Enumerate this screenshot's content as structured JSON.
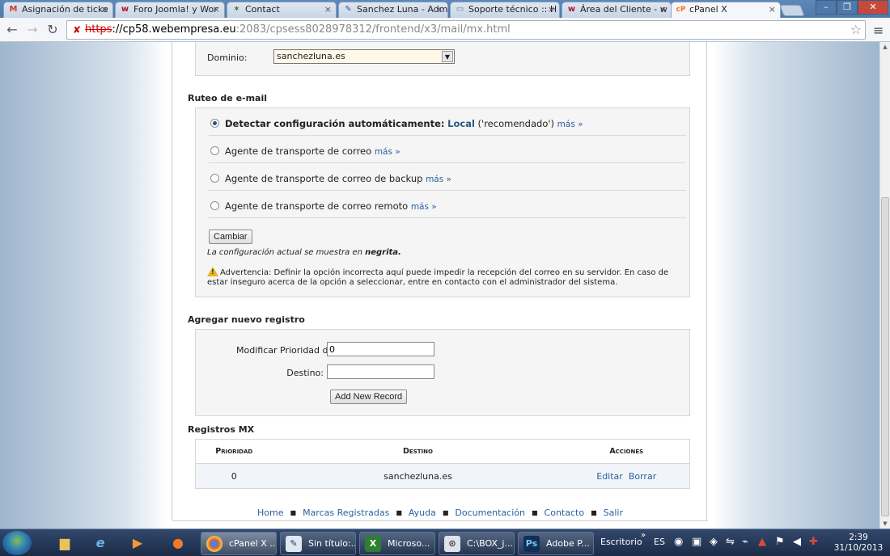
{
  "browser": {
    "tabs": [
      {
        "label": "Asignación de ticke",
        "icon": "gmail-icon",
        "favicon_text": "M",
        "favicon_color": "#cc3b2c"
      },
      {
        "label": "Foro Joomla! y Wor",
        "icon": "webempresa-icon",
        "favicon_text": "w",
        "favicon_color": "#b5122d"
      },
      {
        "label": "Contact",
        "icon": "joomla-icon",
        "favicon_text": "✶",
        "favicon_color": "#2f6e35"
      },
      {
        "label": "Sanchez Luna - Adm",
        "icon": "pencil-icon",
        "favicon_text": "✎",
        "favicon_color": "#2c5fa0"
      },
      {
        "label": "Soporte técnico :: H",
        "icon": "page-icon",
        "favicon_text": "▭",
        "favicon_color": "#777777"
      },
      {
        "label": "Área del Cliente - w",
        "icon": "webempresa-icon",
        "favicon_text": "w",
        "favicon_color": "#b5122d"
      },
      {
        "label": "cPanel X",
        "icon": "cpanel-icon",
        "favicon_text": "cP",
        "favicon_color": "#ff6c2c"
      }
    ],
    "url": {
      "scheme": "https",
      "host": "://cp58.webempresa.eu",
      "path": ":2083/cpsess8028978312/frontend/x3/mail/mx.html"
    }
  },
  "page": {
    "domain_label": "Dominio:",
    "domain_value": "sanchezluna.es",
    "routing": {
      "title": "Ruteo de e-mail",
      "options": [
        {
          "label": "Detectar configuración automáticamente:",
          "bold": true,
          "extra_local": "Local",
          "extra_rest": " ('recomendado')",
          "more": "más »",
          "checked": true
        },
        {
          "label": "Agente de transporte de correo",
          "bold": false,
          "more": "más »",
          "checked": false
        },
        {
          "label": "Agente de transporte de correo de backup",
          "bold": false,
          "more": "más »",
          "checked": false
        },
        {
          "label": "Agente de transporte de correo remoto",
          "bold": false,
          "more": "más »",
          "checked": false
        }
      ],
      "change_button": "Cambiar",
      "current_note_prefix": "La configuración actual se muestra en ",
      "current_note_bold": "negrita.",
      "warning": "Advertencia: Definir la opción incorrecta aquí puede impedir la recepción del correo en su servidor. En caso de estar inseguro acerca de la opción a seleccionar, entre en contacto con el administrador del sistema."
    },
    "new_record": {
      "title": "Agregar nuevo registro",
      "priority_label": "Modificar Prioridad de",
      "priority_value": "0",
      "destination_label": "Destino:",
      "destination_value": "",
      "add_button": "Add New Record"
    },
    "mx_records": {
      "title": "Registros MX",
      "columns": [
        "Prioridad",
        "Destino",
        "Acciones"
      ],
      "rows": [
        {
          "priority": "0",
          "destination": "sanchezluna.es",
          "edit": "Editar",
          "delete": "Borrar"
        }
      ]
    },
    "footer_links": [
      "Home",
      "Marcas Registradas",
      "Ayuda",
      "Documentación",
      "Contacto",
      "Salir"
    ]
  },
  "taskbar": {
    "buttons": [
      {
        "label": "cPanel X ...",
        "icon": "chrome-icon"
      },
      {
        "label": "Sin título:...",
        "icon": "notepad-icon"
      },
      {
        "label": "Microso...",
        "icon": "excel-icon"
      },
      {
        "label": "C:\\BOX_j...",
        "icon": "vpn-icon"
      },
      {
        "label": "Adobe P...",
        "icon": "photoshop-icon"
      }
    ],
    "desktop_label": "Escritorio",
    "lang": "ES",
    "time": "2:39",
    "date": "31/10/2013"
  }
}
